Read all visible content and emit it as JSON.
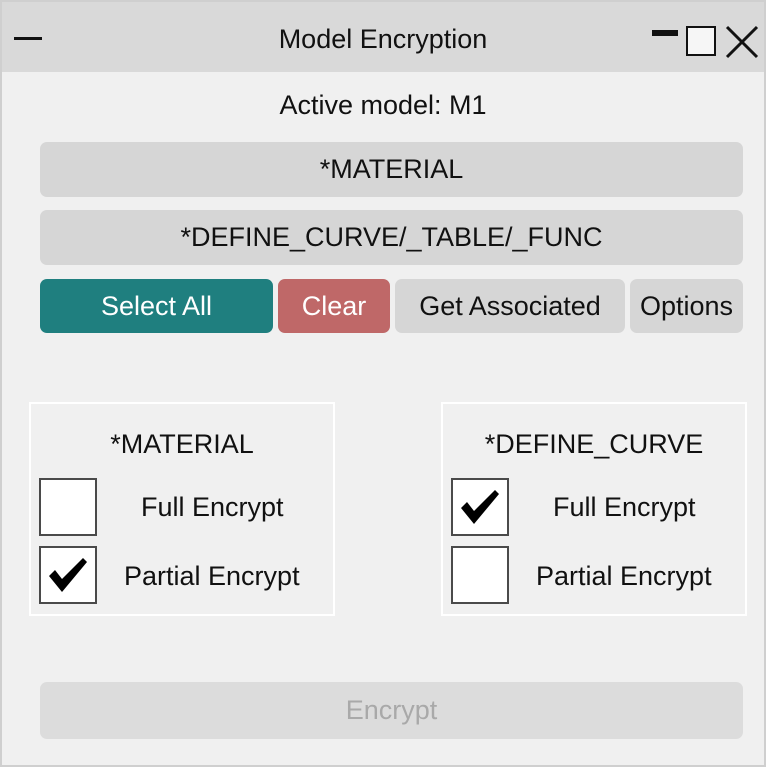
{
  "window": {
    "title": "Model Encryption",
    "controls": [
      "menu-icon",
      "minimize-icon",
      "maximize-icon",
      "close-icon"
    ]
  },
  "active_model_text": "Active model: M1",
  "keyword_buttons": {
    "material": "*MATERIAL",
    "define_curve": "*DEFINE_CURVE/_TABLE/_FUNC"
  },
  "actions": {
    "select_all": "Select All",
    "clear": "Clear",
    "get_associated": "Get Associated",
    "options": "Options"
  },
  "panels": {
    "material": {
      "title": "*MATERIAL",
      "full_label": "Full Encrypt",
      "partial_label": "Partial Encrypt",
      "full_checked": false,
      "partial_checked": true
    },
    "define_curve": {
      "title": "*DEFINE_CURVE",
      "full_label": "Full Encrypt",
      "partial_label": "Partial Encrypt",
      "full_checked": true,
      "partial_checked": false
    }
  },
  "encrypt_button": {
    "label": "Encrypt",
    "enabled": false
  },
  "colors": {
    "select_all_bg": "#1f7f7f",
    "clear_bg": "#bf6868",
    "button_bg": "#d6d6d6",
    "disabled_text": "#a9a9a9"
  }
}
